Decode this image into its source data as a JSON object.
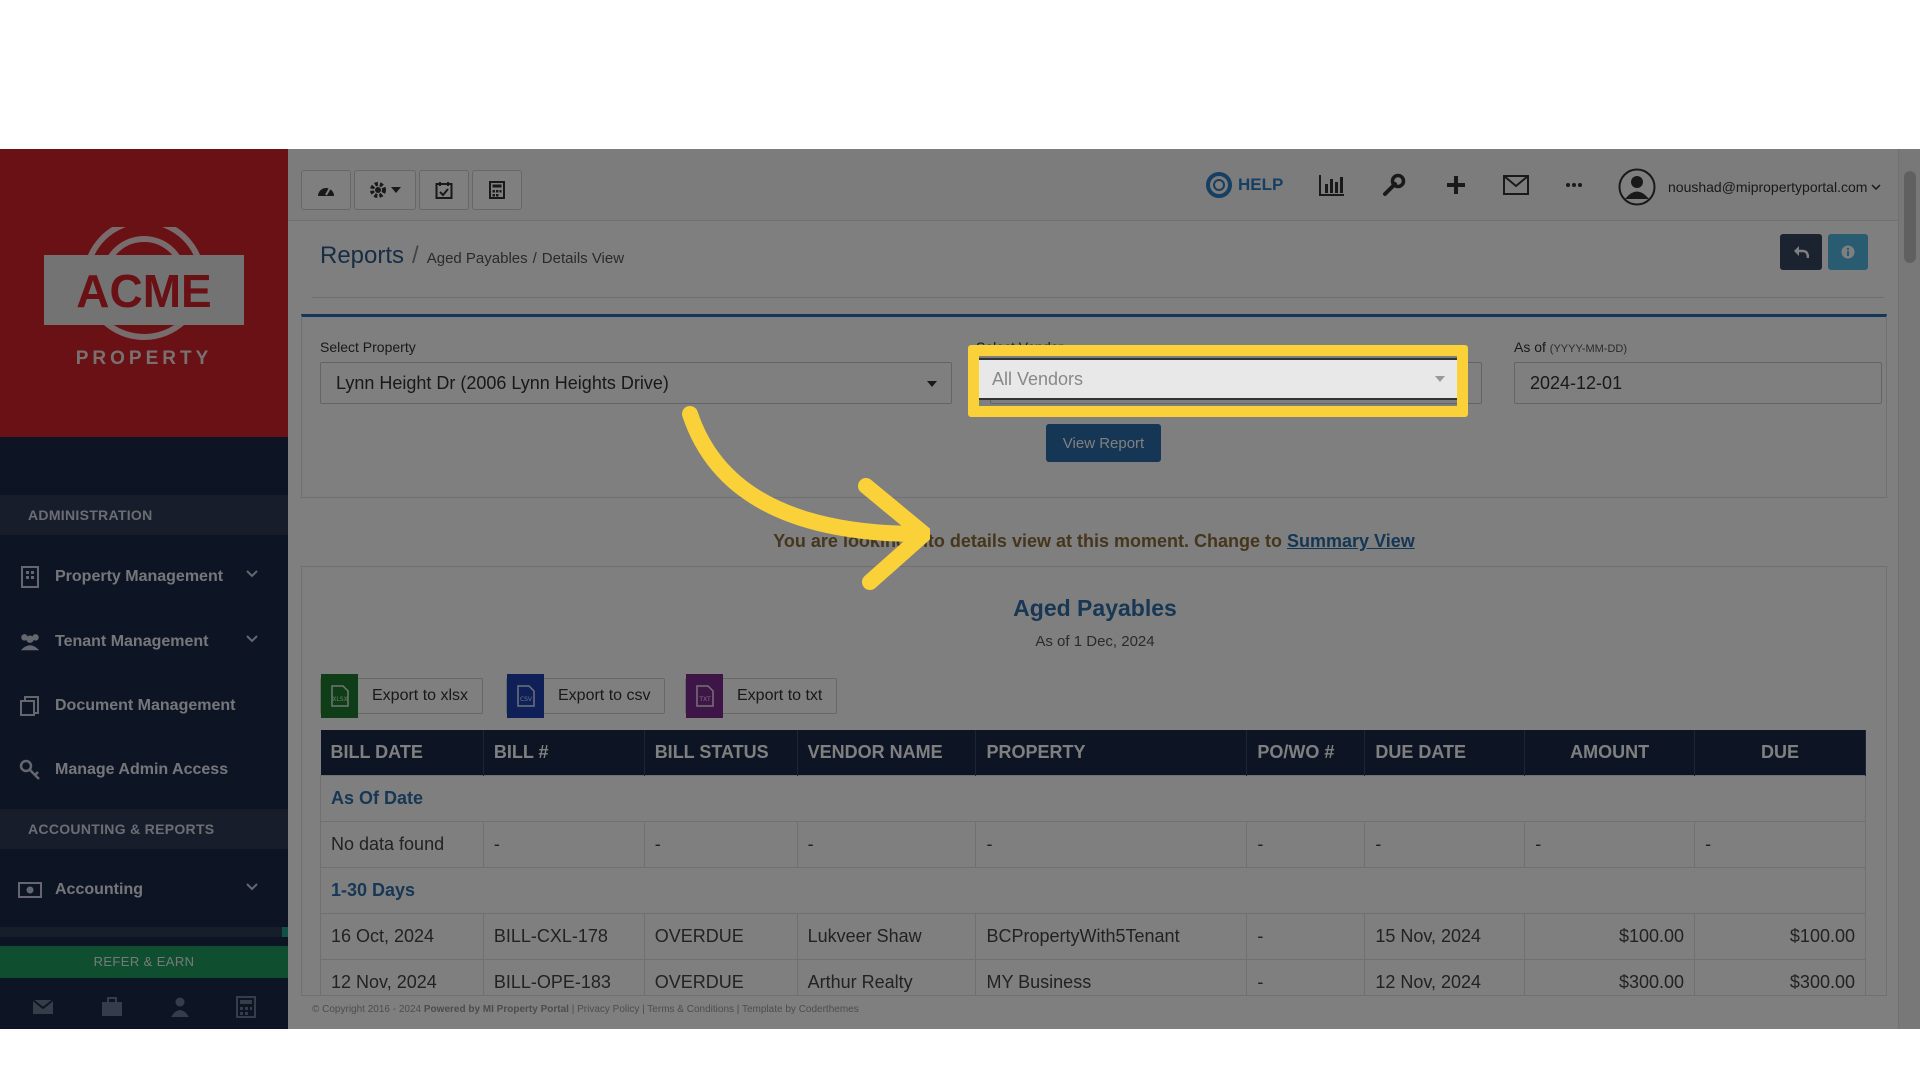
{
  "logo": {
    "brand": "ACME",
    "sub": "PROPERTY"
  },
  "sidebar": {
    "sections": [
      {
        "label": "ADMINISTRATION"
      },
      {
        "label": "ACCOUNTING & REPORTS"
      }
    ],
    "items": [
      {
        "label": "Property Management",
        "icon": "building-icon",
        "has_chevron": true
      },
      {
        "label": "Tenant Management",
        "icon": "users-icon",
        "has_chevron": true
      },
      {
        "label": "Document Management",
        "icon": "documents-icon",
        "has_chevron": false
      },
      {
        "label": "Manage Admin Access",
        "icon": "key-icon",
        "has_chevron": false
      },
      {
        "label": "Accounting",
        "icon": "money-icon",
        "has_chevron": true
      }
    ],
    "refer_label": "REFER & EARN"
  },
  "topbar": {
    "help_label": "HELP",
    "user_email": "noushad@mipropertyportal.com"
  },
  "breadcrumb": {
    "root": "Reports",
    "separator": "/",
    "middle": "Aged Payables",
    "leaf": "Details View",
    "sep2": "/"
  },
  "filters": {
    "property_label": "Select Property",
    "property_value": "Lynn Height Dr (2006 Lynn Heights Drive)",
    "vendor_label": "Select Vendor",
    "vendor_value": "All Vendors",
    "asof_label": "As of",
    "asof_hint": "(YYYY-MM-DD)",
    "asof_value": "2024-12-01",
    "view_report_label": "View Report"
  },
  "details_message": {
    "text": "You are looking into details view at this moment. Change to",
    "link": "Summary View"
  },
  "report": {
    "title": "Aged Payables",
    "subtitle": "As of 1 Dec, 2024",
    "exports": [
      {
        "label": "Export to xlsx",
        "badge": "XLSX",
        "color": "#1e7a2f"
      },
      {
        "label": "Export to csv",
        "badge": "CSV",
        "color": "#1f3fb0"
      },
      {
        "label": "Export to txt",
        "badge": "TXT",
        "color": "#7b2a8c"
      }
    ],
    "columns": [
      "BILL DATE",
      "BILL #",
      "BILL STATUS",
      "VENDOR NAME",
      "PROPERTY",
      "PO/WO #",
      "DUE DATE",
      "AMOUNT",
      "DUE"
    ],
    "groups": [
      {
        "label": "As Of Date",
        "rows": [
          [
            "No data found",
            "-",
            "-",
            "-",
            "-",
            "-",
            "-",
            "-",
            "-"
          ]
        ]
      },
      {
        "label": "1-30 Days",
        "rows": [
          [
            "16 Oct, 2024",
            "BILL-CXL-178",
            "OVERDUE",
            "Lukveer Shaw",
            "BCPropertyWith5Tenant",
            "-",
            "15 Nov, 2024",
            "$100.00",
            "$100.00"
          ],
          [
            "12 Nov, 2024",
            "BILL-OPE-183",
            "OVERDUE",
            "Arthur Realty",
            "MY Business",
            "-",
            "12 Nov, 2024",
            "$300.00",
            "$300.00"
          ]
        ]
      }
    ]
  },
  "footer": {
    "copyright": "© Copyright 2016 - 2024",
    "powered": "Powered by MI Property Portal",
    "links": "| Privacy Policy | Terms & Conditions |",
    "template": "Template by Coderthemes"
  },
  "colors": {
    "brand_red": "#d2232a",
    "sidebar_navy": "#1b2a49",
    "accent_blue": "#2a6eab",
    "highlight_yellow": "#fbd13a",
    "overdue_red": "#c0392b"
  }
}
